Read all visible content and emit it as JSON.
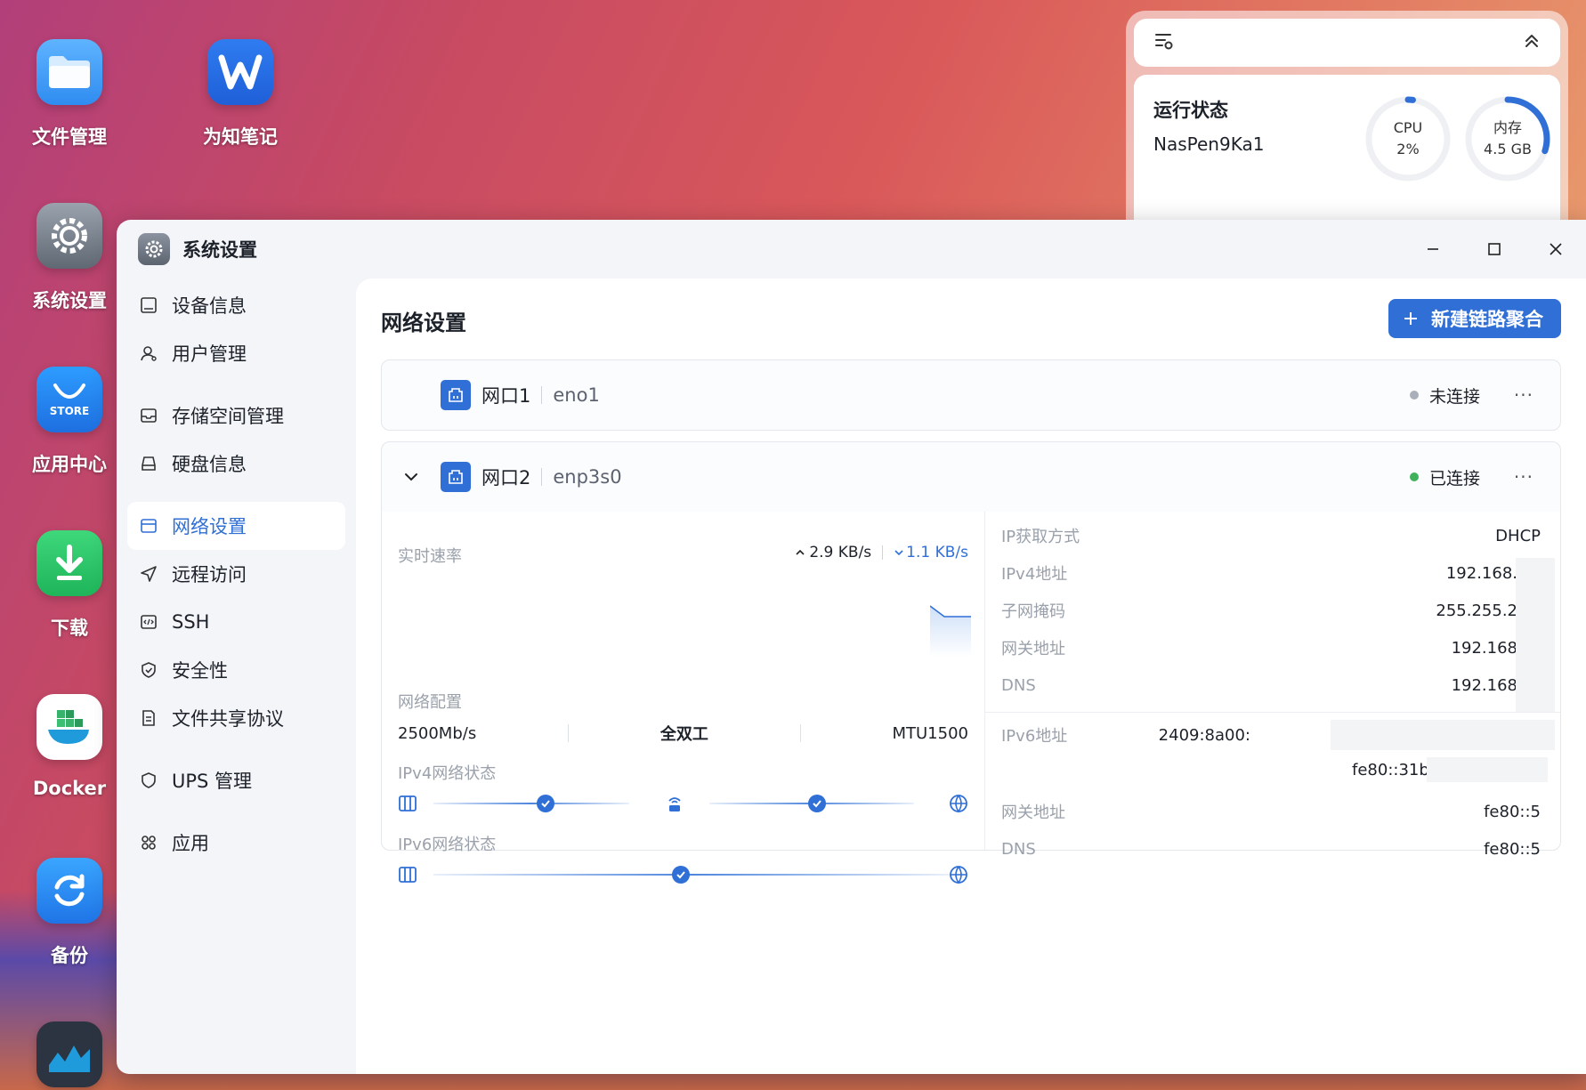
{
  "desktop": {
    "icons": [
      {
        "label": "文件管理"
      },
      {
        "label": "为知笔记"
      },
      {
        "label": "系统设置"
      },
      {
        "label": "应用中心",
        "badge": "STORE"
      },
      {
        "label": "下载"
      },
      {
        "label": "Docker"
      },
      {
        "label": "备份"
      }
    ]
  },
  "widget": {
    "title": "运行状态",
    "host": "NasPen9Ka1",
    "cpu": {
      "label": "CPU",
      "value": "2%",
      "fraction": 0.02
    },
    "mem": {
      "label": "内存",
      "value": "4.5 GB",
      "fraction": 0.3
    }
  },
  "window": {
    "title": "系统设置",
    "sidebar": [
      {
        "label": "设备信息",
        "icon": "device-icon"
      },
      {
        "label": "用户管理",
        "icon": "user-icon"
      },
      {
        "label": "存储空间管理",
        "icon": "storage-icon"
      },
      {
        "label": "硬盘信息",
        "icon": "disk-icon"
      },
      {
        "label": "网络设置",
        "icon": "network-icon",
        "active": true
      },
      {
        "label": "远程访问",
        "icon": "send-icon"
      },
      {
        "label": "SSH",
        "icon": "code-icon"
      },
      {
        "label": "安全性",
        "icon": "shield-check-icon"
      },
      {
        "label": "文件共享协议",
        "icon": "document-icon"
      },
      {
        "label": "UPS 管理",
        "icon": "shield-icon"
      },
      {
        "label": "应用",
        "icon": "apps-icon"
      }
    ]
  },
  "network": {
    "title": "网络设置",
    "new_button": "新建链路聚合",
    "port1": {
      "name": "网口1",
      "iface": "eno1",
      "status": "未连接",
      "status_color": "#a9b0ba"
    },
    "port2": {
      "name": "网口2",
      "iface": "enp3s0",
      "status": "已连接",
      "status_color": "#3fb15a",
      "speed_label": "实时速率",
      "upload": "2.9 KB/s",
      "download": "1.1 KB/s",
      "config_label": "网络配置",
      "link_speed": "2500Mb/s",
      "duplex": "全双工",
      "mtu": "MTU1500",
      "ipv4_status_label": "IPv4网络状态",
      "ipv6_status_label": "IPv6网络状态",
      "ipv4": [
        {
          "k": "IP获取方式",
          "v": "DHCP"
        },
        {
          "k": "IPv4地址",
          "v": "192.168."
        },
        {
          "k": "子网掩码",
          "v": "255.255.2"
        },
        {
          "k": "网关地址",
          "v": "192.168"
        },
        {
          "k": "DNS",
          "v": "192.168"
        }
      ],
      "ipv6_label": "IPv6地址",
      "ipv6_addr1": "2409:8a00:",
      "ipv6_addr2": "fe80::31b",
      "ipv6_gateway_label": "网关地址",
      "ipv6_gateway": "fe80::5",
      "ipv6_dns_label": "DNS",
      "ipv6_dns": "fe80::5"
    }
  }
}
